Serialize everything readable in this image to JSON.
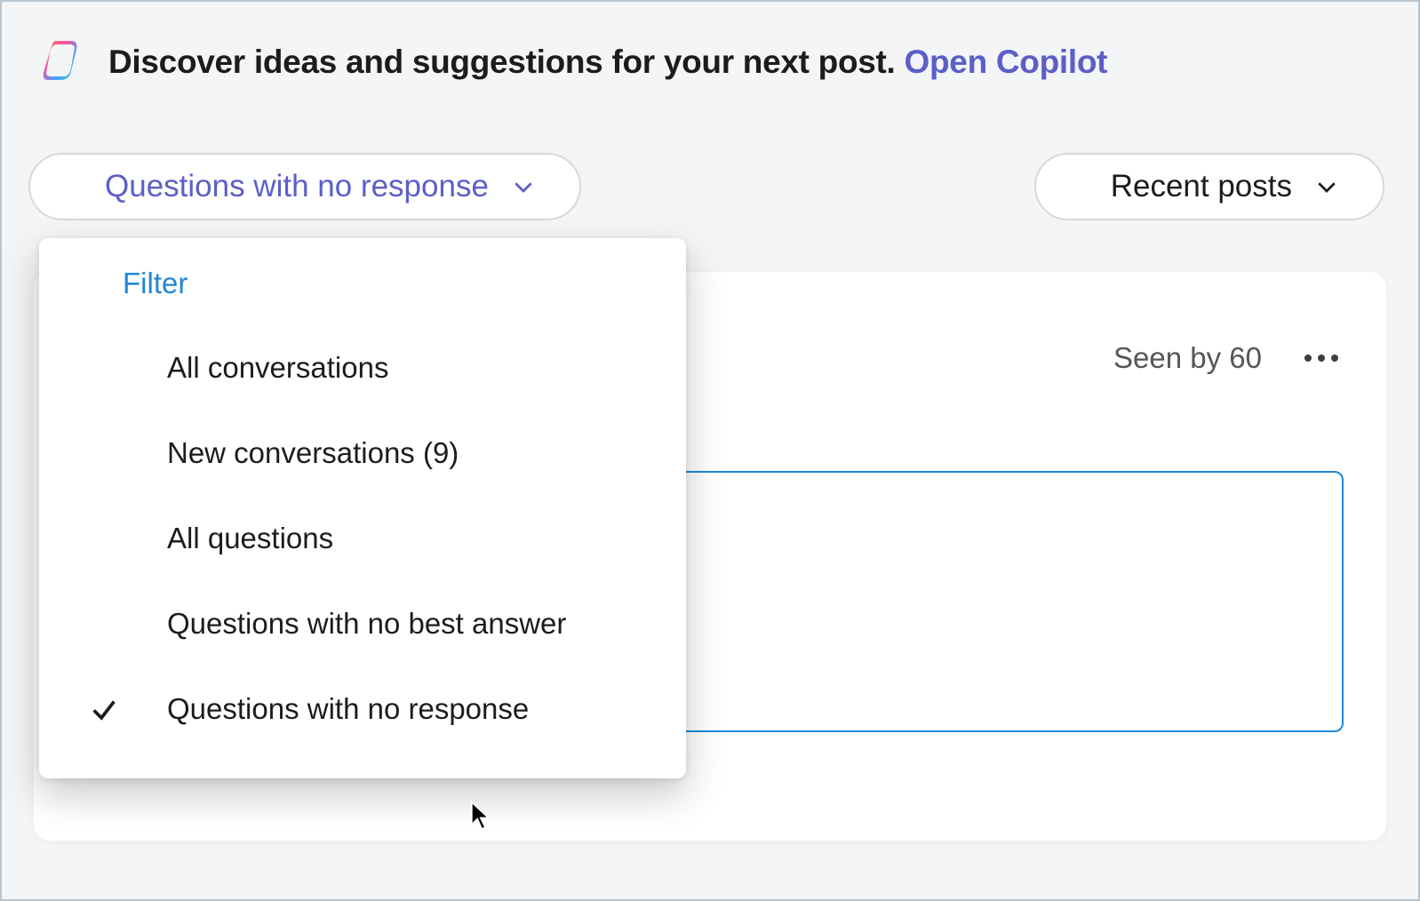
{
  "banner": {
    "text": "Discover ideas and suggestions for your next post.",
    "link": "Open Copilot"
  },
  "controls": {
    "filter_label": "Questions with no response",
    "sort_label": "Recent posts"
  },
  "dropdown": {
    "header": "Filter",
    "items": [
      {
        "label": "All conversations",
        "selected": false
      },
      {
        "label": "New conversations (9)",
        "selected": false
      },
      {
        "label": "All questions",
        "selected": false
      },
      {
        "label": "Questions with no best answer",
        "selected": false
      },
      {
        "label": "Questions with no response",
        "selected": true
      }
    ]
  },
  "post": {
    "seen_by": "Seen by 60"
  }
}
